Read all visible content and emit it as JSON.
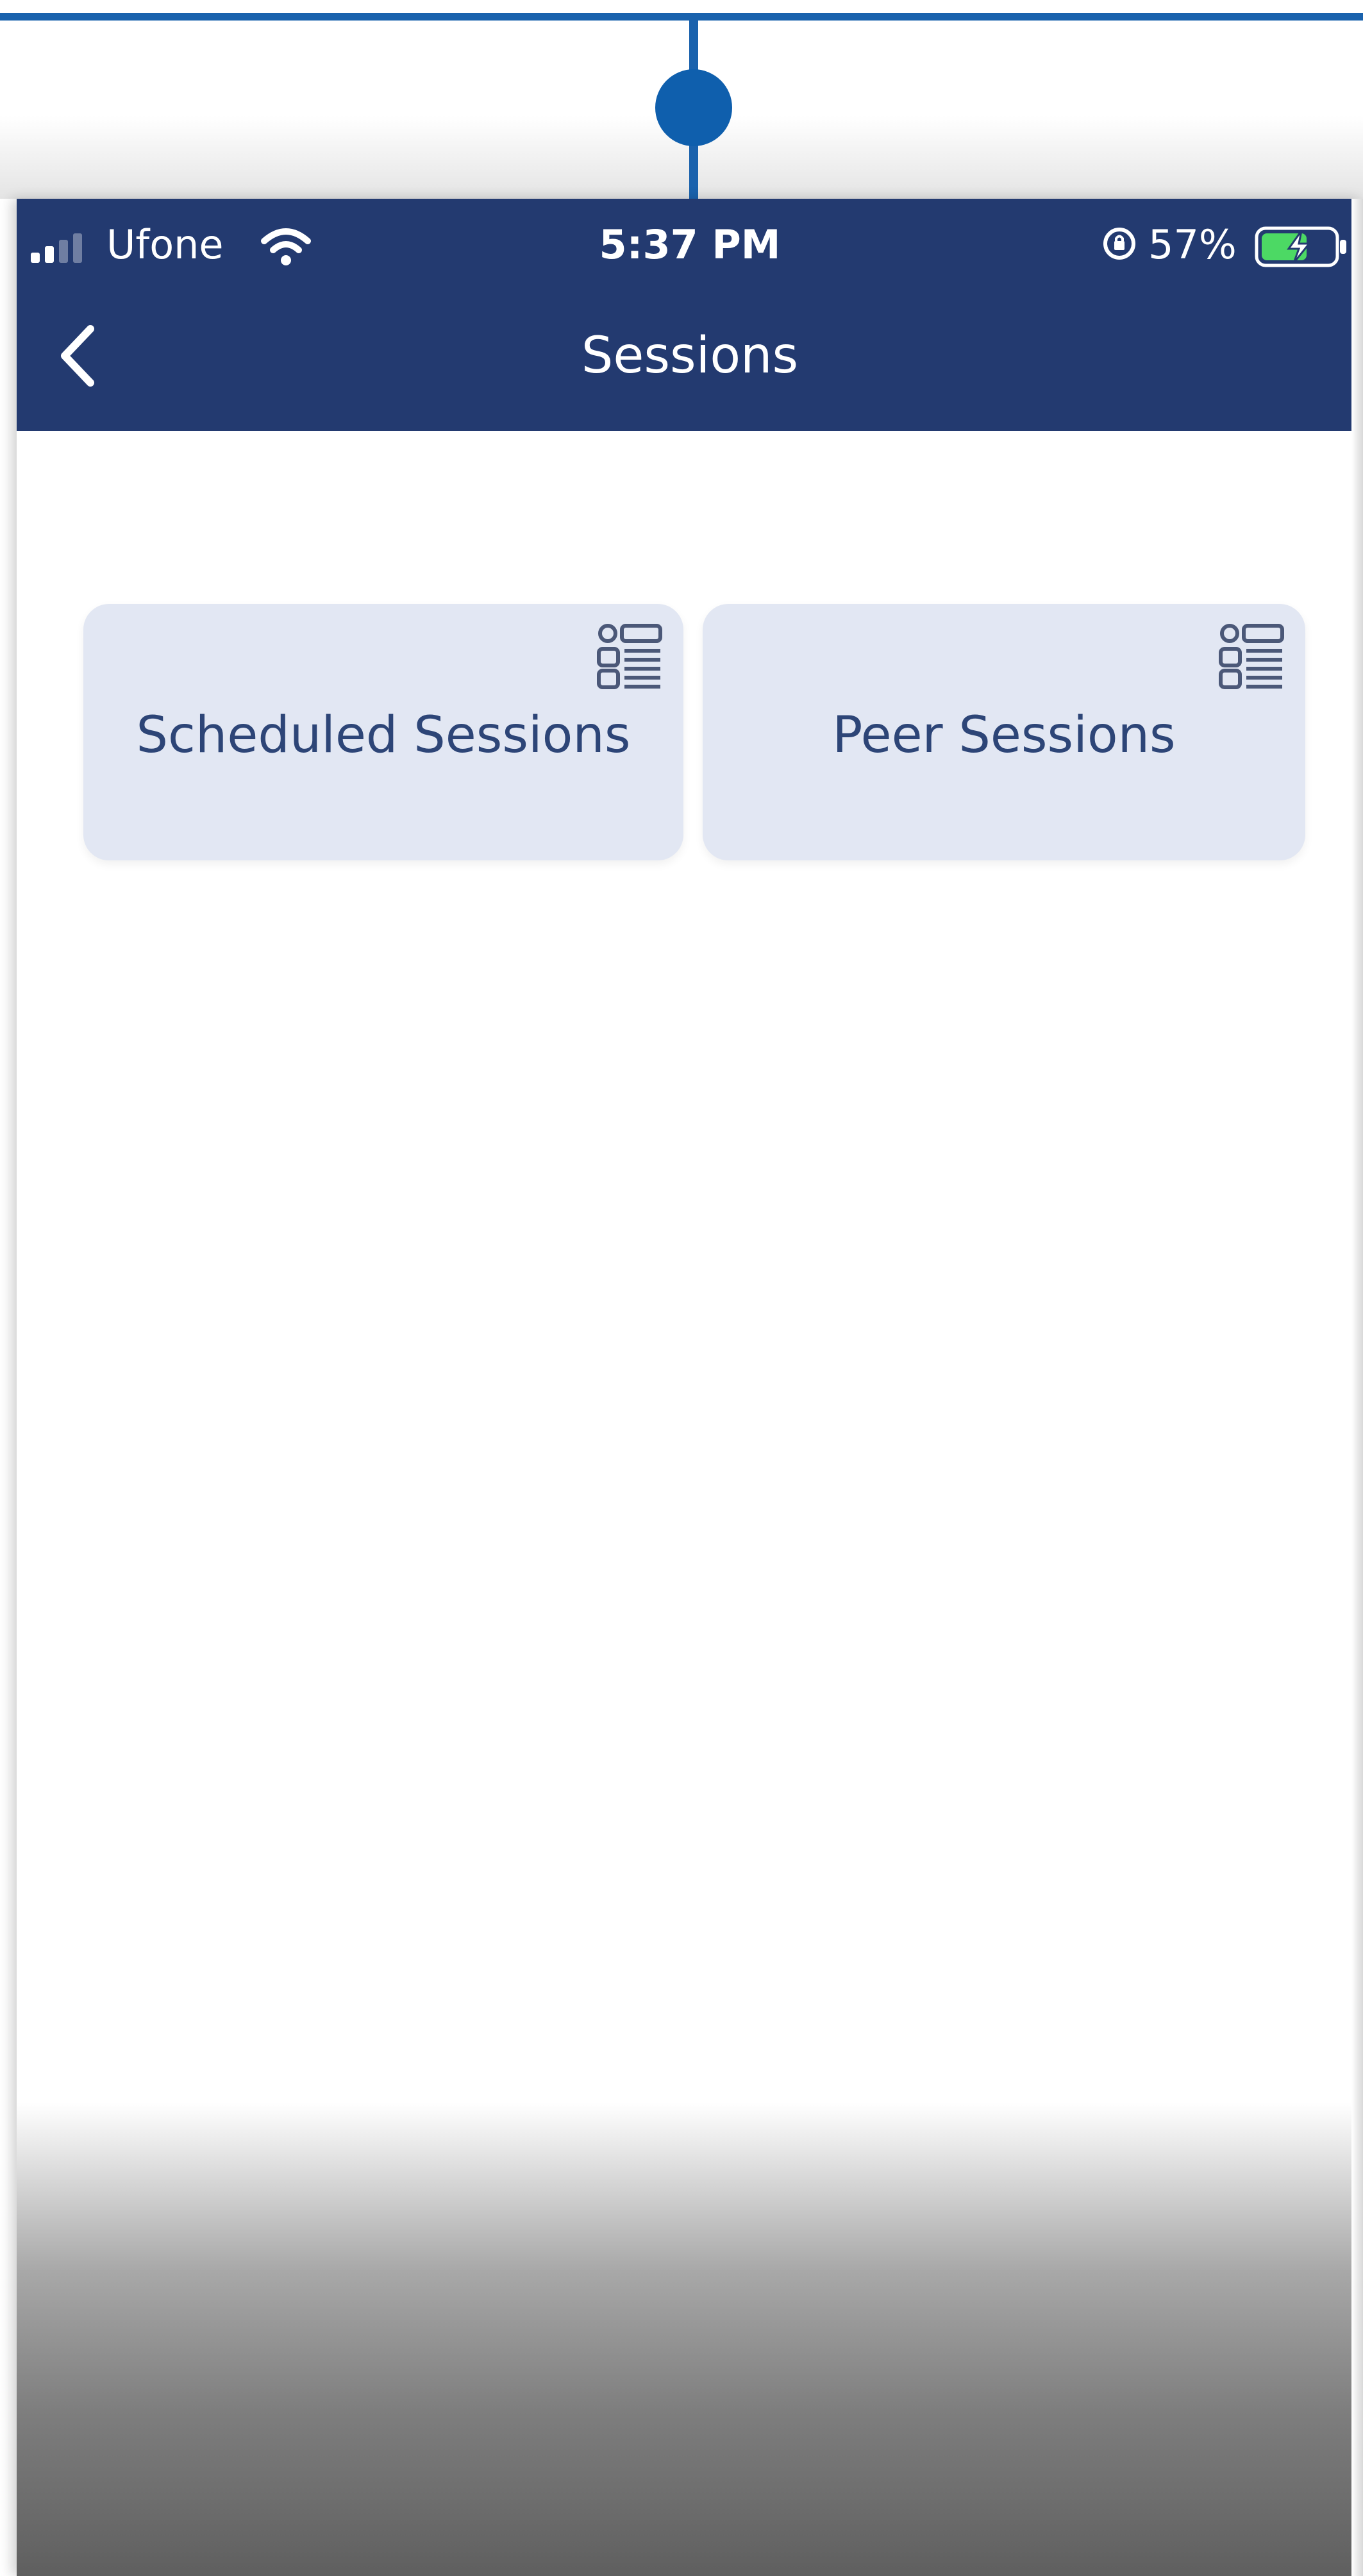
{
  "status_bar": {
    "carrier": "Ufone",
    "time": "5:37 PM",
    "battery_percent": "57%"
  },
  "header": {
    "title": "Sessions",
    "back_icon": "chevron-left-icon"
  },
  "cards": [
    {
      "label": "Scheduled Sessions",
      "icon": "list-details-icon"
    },
    {
      "label": "Peer Sessions",
      "icon": "list-details-icon"
    }
  ],
  "colors": {
    "header_bg": "#233a70",
    "card_bg": "#e2e7f3",
    "card_text": "#2d4577",
    "connector": "#1a62ad"
  }
}
